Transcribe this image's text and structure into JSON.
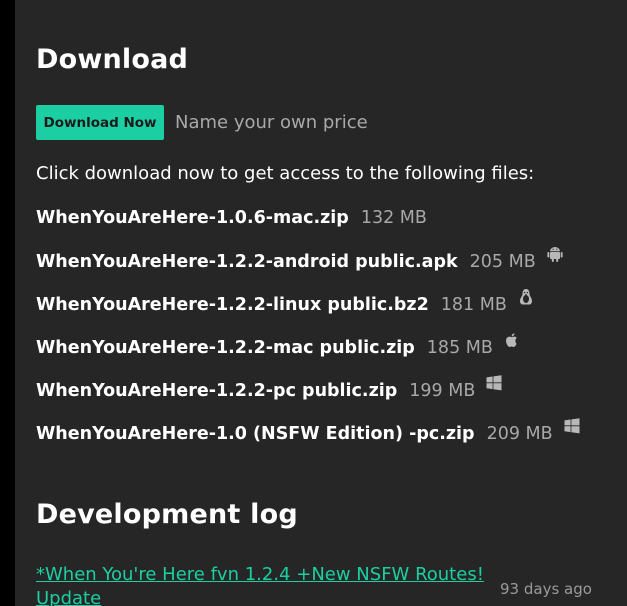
{
  "download": {
    "heading": "Download",
    "button_label": "Download Now",
    "price_text": "Name your own price",
    "intro": "Click download now to get access to the following files:"
  },
  "files": [
    {
      "name": "WhenYouAreHere-1.0.6-mac.zip",
      "size": "132 MB",
      "icon": ""
    },
    {
      "name": "WhenYouAreHere-1.2.2-android public.apk",
      "size": "205 MB",
      "icon": "android-icon"
    },
    {
      "name": "WhenYouAreHere-1.2.2-linux public.bz2",
      "size": "181 MB",
      "icon": "linux-icon"
    },
    {
      "name": "WhenYouAreHere-1.2.2-mac public.zip",
      "size": "185 MB",
      "icon": "apple-icon"
    },
    {
      "name": "WhenYouAreHere-1.2.2-pc public.zip",
      "size": "199 MB",
      "icon": "windows-icon"
    },
    {
      "name": "WhenYouAreHere-1.0 (NSFW Edition) -pc.zip",
      "size": "209 MB",
      "icon": "windows-icon"
    }
  ],
  "devlog": {
    "heading": "Development log",
    "entry_title": "*When You're Here fvn 1.2.4 +New NSFW Routes! Update",
    "entry_date": "93 days ago"
  },
  "colors": {
    "accent": "#1ccfa2",
    "panel_bg": "#262626",
    "page_bg": "#000000",
    "muted_text": "#a8a8a8"
  }
}
